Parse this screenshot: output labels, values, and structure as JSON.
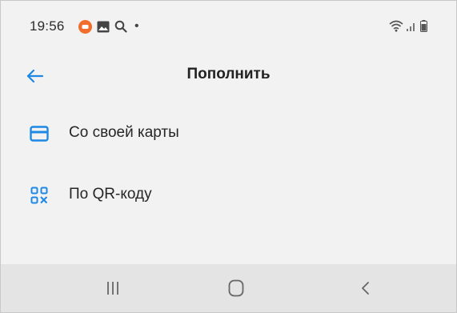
{
  "status_bar": {
    "time": "19:56",
    "dot": "•",
    "icons": [
      "notification-app-icon",
      "gallery-icon",
      "search-icon",
      "wifi-icon",
      "signal-icon",
      "battery-icon"
    ]
  },
  "app_bar": {
    "title": "Пополнить",
    "back_icon": "arrow-left-icon"
  },
  "options": [
    {
      "label": "Со своей карты",
      "icon": "card-icon"
    },
    {
      "label": "По QR-коду",
      "icon": "qr-code-icon"
    }
  ],
  "nav_bar": {
    "buttons": [
      "recent-apps-icon",
      "home-icon",
      "back-icon"
    ]
  },
  "colors": {
    "accent": "#1e88e5",
    "background": "#f2f2f2",
    "nav_background": "#e4e4e4",
    "notification": "#f26c2b"
  }
}
